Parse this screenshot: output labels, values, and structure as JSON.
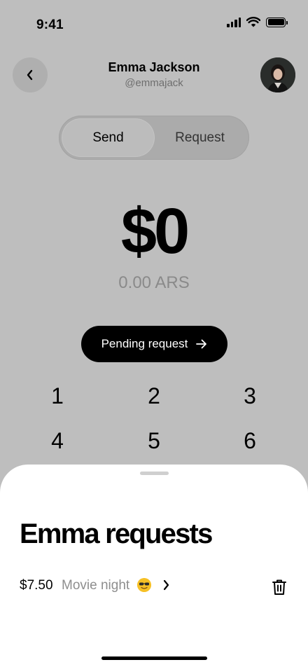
{
  "status": {
    "time": "9:41"
  },
  "header": {
    "name": "Emma Jackson",
    "handle": "@emmajack"
  },
  "toggle": {
    "send_label": "Send",
    "request_label": "Request",
    "active": "Send"
  },
  "amount": {
    "value": "$0",
    "converted": "0.00 ARS"
  },
  "pending_button": {
    "label": "Pending request"
  },
  "keypad": {
    "keys": [
      "1",
      "2",
      "3",
      "4",
      "5",
      "6"
    ]
  },
  "sheet": {
    "title": "Emma requests",
    "requests": [
      {
        "amount": "$7.50",
        "note": "Movie night",
        "emoji": "smiling-face-with-sunglasses"
      }
    ]
  },
  "colors": {
    "background": "#bebebe",
    "sheet": "#ffffff",
    "primary_button": "#000000",
    "muted_text": "#8e8e8e"
  }
}
